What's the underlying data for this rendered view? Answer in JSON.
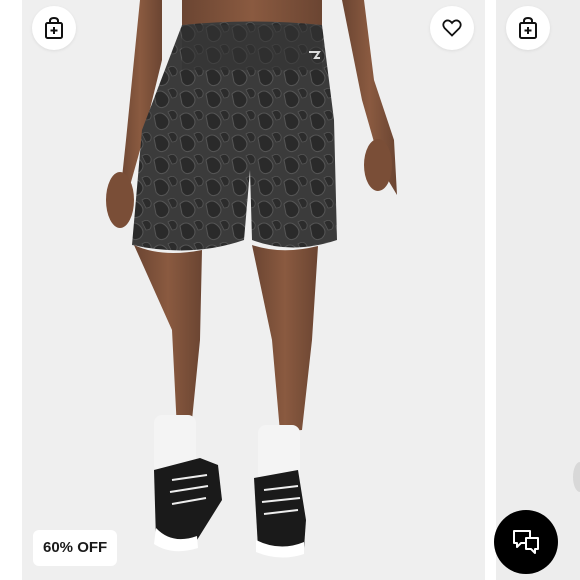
{
  "product_card": {
    "discount_badge": "60% OFF",
    "add_to_bag_icon": "shopping-bag-plus-icon",
    "wishlist_icon": "heart-outline-icon"
  },
  "next_card": {
    "add_to_bag_icon": "shopping-bag-plus-icon"
  },
  "chat": {
    "icon": "chat-bubbles-icon"
  },
  "colors": {
    "card_background": "#efefef",
    "badge_text": "#1a1a1a",
    "chat_button": "#000000",
    "shorts": "#3a3a3a"
  }
}
